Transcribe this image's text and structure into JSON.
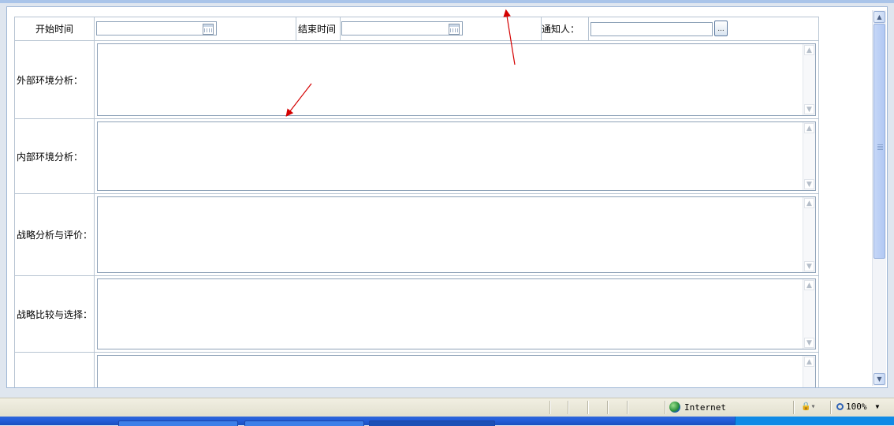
{
  "form": {
    "start_label": "开始时间",
    "end_label": "结束时间",
    "notify_label": "通知人：",
    "picker_button": "...",
    "external_label": "外部环境分析：",
    "internal_label": "内部环境分析：",
    "strategy_eval_label": "战略分析与评价：",
    "strategy_select_label": "战略比较与选择：",
    "start_value": "",
    "end_value": "",
    "notify_value": ""
  },
  "status": {
    "zone": "Internet",
    "zoom": "100%"
  },
  "icons": {
    "calendar": "calendar-icon",
    "globe": "globe-icon",
    "zoom": "zoom-icon",
    "lock": "lock-icon"
  },
  "colors": {
    "annotation_arrow": "#d40000",
    "table_border": "#b7c4d2",
    "taskbar": "#245edb"
  }
}
